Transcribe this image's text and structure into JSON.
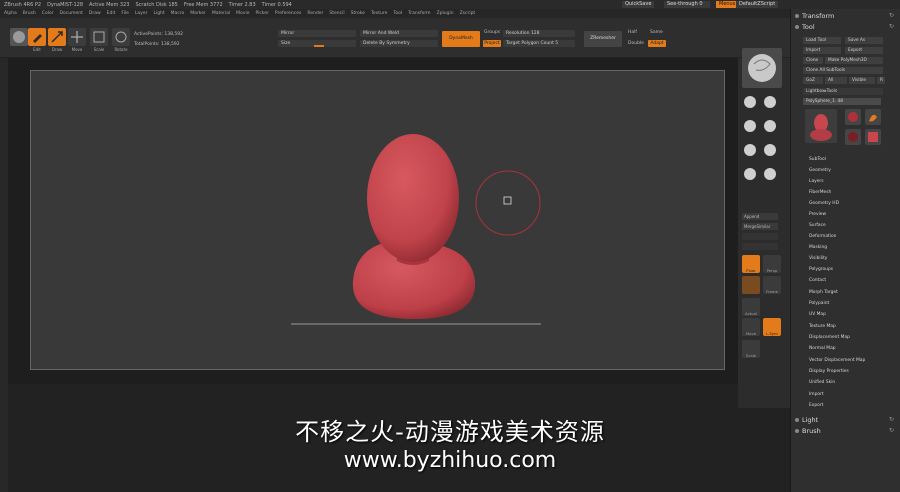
{
  "titlebar": {
    "items": [
      "ZBrush 4R6 P2",
      "DynaMIST-128",
      "Active Mem 323",
      "Scratch Disk 185",
      "Free Mem 3772",
      "Timer 2.83",
      "Timer 0.594"
    ],
    "quicksave": "QuickSave",
    "seethrough": "See-through 0",
    "menus_btn": "Menus",
    "script": "DefaultZScript"
  },
  "menubar": {
    "items": [
      "Alpha",
      "Brush",
      "Color",
      "Document",
      "Draw",
      "Edit",
      "File",
      "Layer",
      "Light",
      "Macro",
      "Marker",
      "Material",
      "Movie",
      "Picker",
      "Preferences",
      "Render",
      "Stencil",
      "Stroke",
      "Texture",
      "Tool",
      "Transform",
      "Zplugin",
      "Zscript"
    ]
  },
  "shelf": {
    "tools": [
      {
        "label": "Edit"
      },
      {
        "label": "Draw"
      },
      {
        "label": "Move"
      },
      {
        "label": "Scale"
      },
      {
        "label": "Rotate"
      }
    ],
    "active_points": "ActivePoints: 138,592",
    "total_points": "TotalPoints: 138,592",
    "mirror": "Mirror",
    "size": "Size",
    "mirror_weld": "Mirror And Weld",
    "delete_symmetry": "Delete By Symmetry",
    "dynamesh": "DynaMesh",
    "groups": "Groups",
    "resolution": "Resolution 128",
    "project": "Project",
    "target_polygons": "Target Polygon Count 5",
    "zremesher": "ZRemesher",
    "half": "Half",
    "same": "Same",
    "double": "Double",
    "adapt": "Adapt"
  },
  "rightshelf": {
    "append": "Append",
    "merge_similar": "MergeSimilar",
    "labels": [
      "Floor",
      "Persp",
      "Frame",
      "Actual",
      "L.Sym",
      "Move",
      "Scale",
      "Rotate"
    ]
  },
  "panel": {
    "transform": "Transform",
    "tool": "Tool",
    "buttons": {
      "load_tool": "Load Tool",
      "save_as": "Save As",
      "import": "Import",
      "export": "Export",
      "clone": "Clone",
      "make_polymesh": "Make PolyMesh3D",
      "clone_all": "Clone All SubTools",
      "goz": "GoZ",
      "all": "All",
      "visible": "Visible",
      "r": "R",
      "lightbox_tools": "Lightbox▸Tools",
      "current_tool": "PolySphere_1. 48"
    },
    "thumb_labels": [
      "PolySphere",
      "SimpleBrush",
      "ZSphere",
      "PolyMesh3D"
    ],
    "items": [
      "SubTool",
      "Geometry",
      "Layers",
      "FiberMesh",
      "Geometry HD",
      "Preview",
      "Surface",
      "Deformation",
      "Masking",
      "Visibility",
      "Polygroups",
      "Contact",
      "Morph Target",
      "Polypaint",
      "UV Map",
      "Texture Map",
      "Displacement Map",
      "Normal Map",
      "Vector Displacement Map",
      "Display Properties",
      "Unified Skin",
      "Import",
      "Export"
    ],
    "light": "Light",
    "brush": "Brush"
  },
  "watermark": {
    "line1": "不移之火-动漫游戏美术资源",
    "line2": "www.byzhihuo.com"
  },
  "colors": {
    "accent": "#e37b1b",
    "model": "#c8464e",
    "canvas_bg": "#393939"
  }
}
